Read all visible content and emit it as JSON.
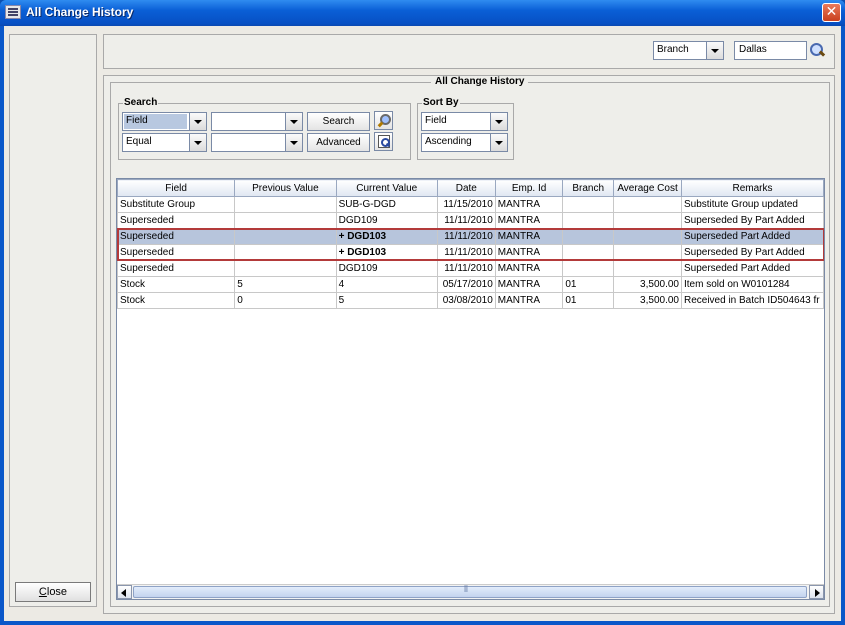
{
  "window": {
    "title": "All Change History",
    "close_glyph": "✕"
  },
  "left_panel": {
    "close_label_hotkey": "C",
    "close_label_rest": "lose"
  },
  "top": {
    "scope_select": "Branch",
    "branch_value": "Dallas"
  },
  "main": {
    "title": "All Change History"
  },
  "search": {
    "legend": "Search",
    "field_select": "Field",
    "value_select": "",
    "operator_select": "Equal",
    "value2_select": "",
    "search_button": "Search",
    "advanced_button": "Advanced"
  },
  "sort": {
    "legend": "Sort By",
    "field_select": "Field",
    "order_select": "Ascending"
  },
  "table": {
    "columns": [
      "Field",
      "Previous Value",
      "Current Value",
      "Date",
      "Emp. Id",
      "Branch",
      "Average Cost",
      "Remarks"
    ],
    "rows": [
      [
        "Substitute Group",
        "",
        "SUB-G-DGD",
        "11/15/2010",
        "MANTRA",
        "",
        "",
        "Substitute Group updated"
      ],
      [
        "Superseded",
        "",
        "DGD109",
        "11/11/2010",
        "MANTRA",
        "",
        "",
        "Superseded By Part Added"
      ],
      [
        "Superseded",
        "",
        "+ DGD103",
        "11/11/2010",
        "MANTRA",
        "",
        "",
        "Superseded Part Added"
      ],
      [
        "Superseded",
        "",
        "+ DGD103",
        "11/11/2010",
        "MANTRA",
        "",
        "",
        "Superseded By Part Added"
      ],
      [
        "Superseded",
        "",
        "DGD109",
        "11/11/2010",
        "MANTRA",
        "",
        "",
        "Superseded Part Added"
      ],
      [
        "Stock",
        "5",
        "4",
        "05/17/2010",
        "MANTRA",
        "01",
        "3,500.00",
        "Item sold on W0101284"
      ],
      [
        "Stock",
        "0",
        "5",
        "03/08/2010",
        "MANTRA",
        "01",
        "3,500.00",
        "Received in Batch ID504643 fr"
      ]
    ],
    "selected_row_index": 2,
    "highlighted_rows": [
      2,
      3
    ]
  },
  "colors": {
    "title_bar": "#0a5fd6",
    "selection": "#b7c5dc",
    "highlight_outline": "#b33a3a"
  },
  "icons": {
    "branch_search": "magnifier-icon",
    "search_find": "find-icon",
    "advanced_find": "advanced-find-icon"
  }
}
